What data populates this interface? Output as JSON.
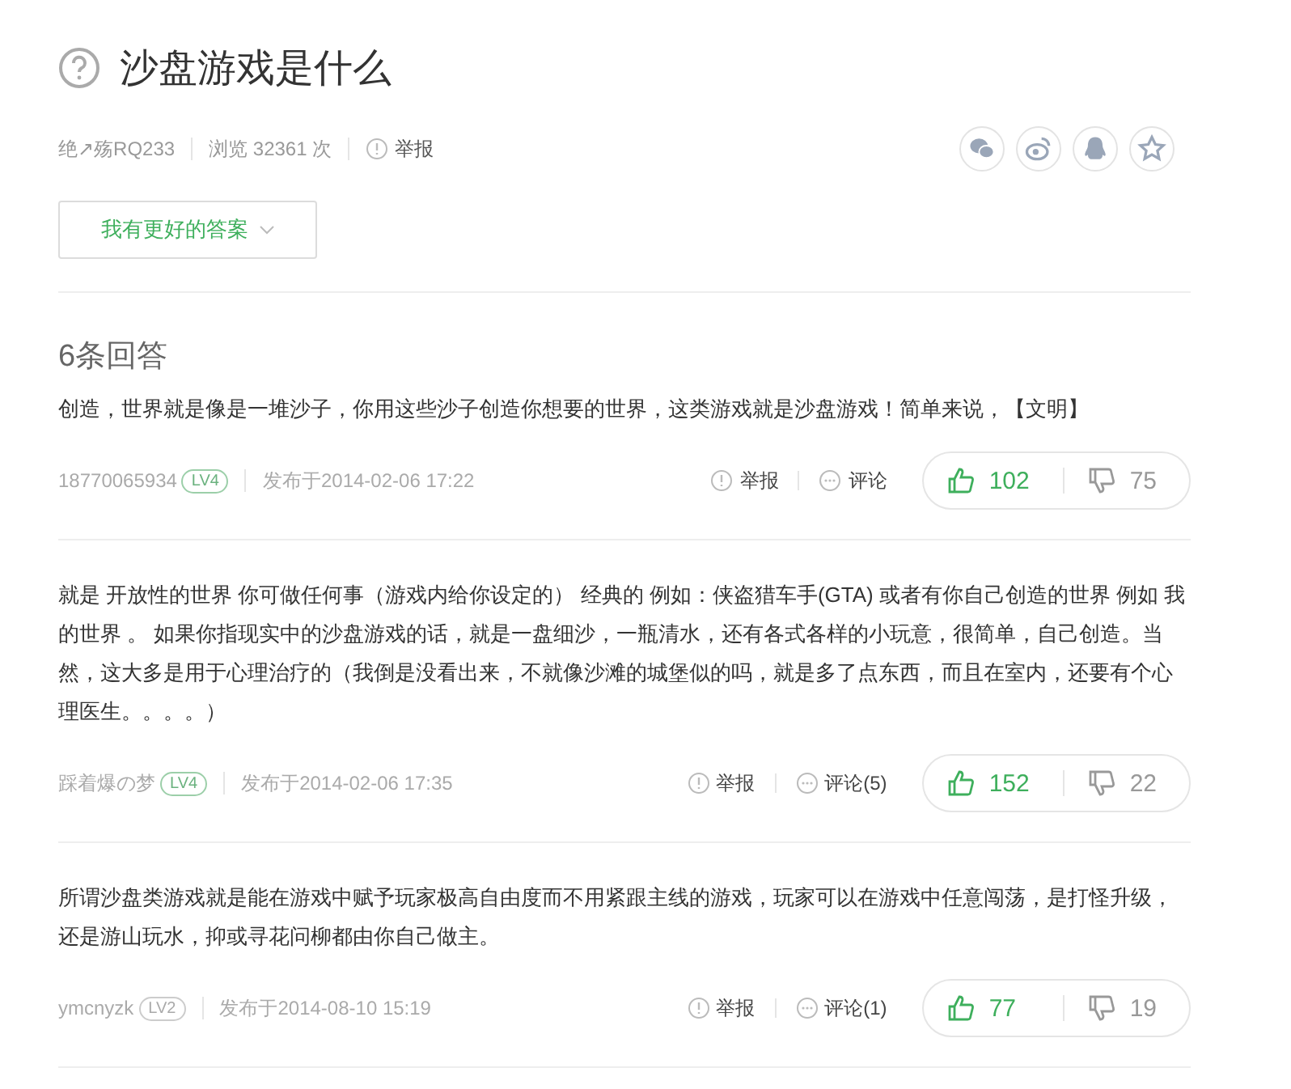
{
  "question": {
    "title": "沙盘游戏是什么",
    "author": "绝↗殇RQ233",
    "views": "浏览 32361 次",
    "report": "举报"
  },
  "share_buttons": [
    {
      "kind": "wechat"
    },
    {
      "kind": "weibo"
    },
    {
      "kind": "qq"
    },
    {
      "kind": "favorite"
    }
  ],
  "better_answer_button": "我有更好的答案",
  "answers_heading": "6条回答",
  "answers": [
    {
      "text": "创造，世界就是像是一堆沙子，你用这些沙子创造你想要的世界，这类游戏就是沙盘游戏！简单来说，【文明】",
      "user": "18770065934",
      "level": "LV4",
      "posted": "发布于2014-02-06 17:22",
      "report": "举报",
      "comment": "评论",
      "likes": "102",
      "dislikes": "75"
    },
    {
      "text": "就是 开放性的世界 你可做任何事（游戏内给你设定的） 经典的 例如：侠盗猎车手(GTA) 或者有你自己创造的世界 例如 我的世界 。 如果你指现实中的沙盘游戏的话，就是一盘细沙，一瓶清水，还有各式各样的小玩意，很简单，自己创造。当然，这大多是用于心理治疗的（我倒是没看出来，不就像沙滩的城堡似的吗，就是多了点东西，而且在室内，还要有个心理医生。。。。）",
      "user": "踩着爆の梦",
      "level": "LV4",
      "posted": "发布于2014-02-06 17:35",
      "report": "举报",
      "comment": "评论(5)",
      "likes": "152",
      "dislikes": "22"
    },
    {
      "text": "所谓沙盘类游戏就是能在游戏中赋予玩家极高自由度而不用紧跟主线的游戏，玩家可以在游戏中任意闯荡，是打怪升级，还是游山玩水，抑或寻花问柳都由你自己做主。",
      "user": "ymcnyzk",
      "level": "LV2",
      "posted": "发布于2014-08-10 15:19",
      "report": "举报",
      "comment": "评论(1)",
      "likes": "77",
      "dislikes": "19"
    }
  ]
}
